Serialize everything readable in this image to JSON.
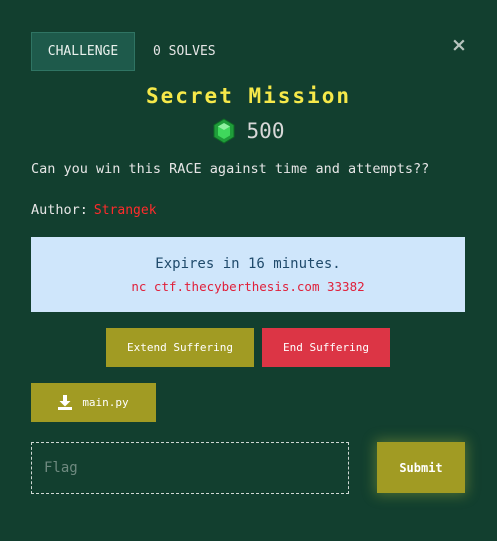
{
  "tabs": {
    "challenge_label": "CHALLENGE",
    "solves_label": "0 SOLVES"
  },
  "close_icon": "×",
  "challenge": {
    "title": "Secret Mission",
    "points": "500",
    "description": "Can you win this RACE against time and attempts??",
    "author_label": "Author:",
    "author_name": "Strangek"
  },
  "instance": {
    "expires_text": "Expires in 16 minutes.",
    "connection": "nc ctf.thecyberthesis.com 33382"
  },
  "buttons": {
    "extend_label": "Extend Suffering",
    "end_label": "End Suffering",
    "download_label": "main.py",
    "submit_label": "Submit"
  },
  "flag_field": {
    "placeholder": "Flag",
    "value": ""
  },
  "colors": {
    "background": "#123f2f",
    "title": "#f6e94a",
    "accent_button": "#a19b23",
    "danger_button": "#dc3545",
    "author": "#ff2b2b",
    "info_box": "#cfe6fb",
    "gem": "#2fbf4a"
  },
  "icons": {
    "points": "green-gem-icon",
    "download": "download-icon",
    "close": "close-icon"
  }
}
